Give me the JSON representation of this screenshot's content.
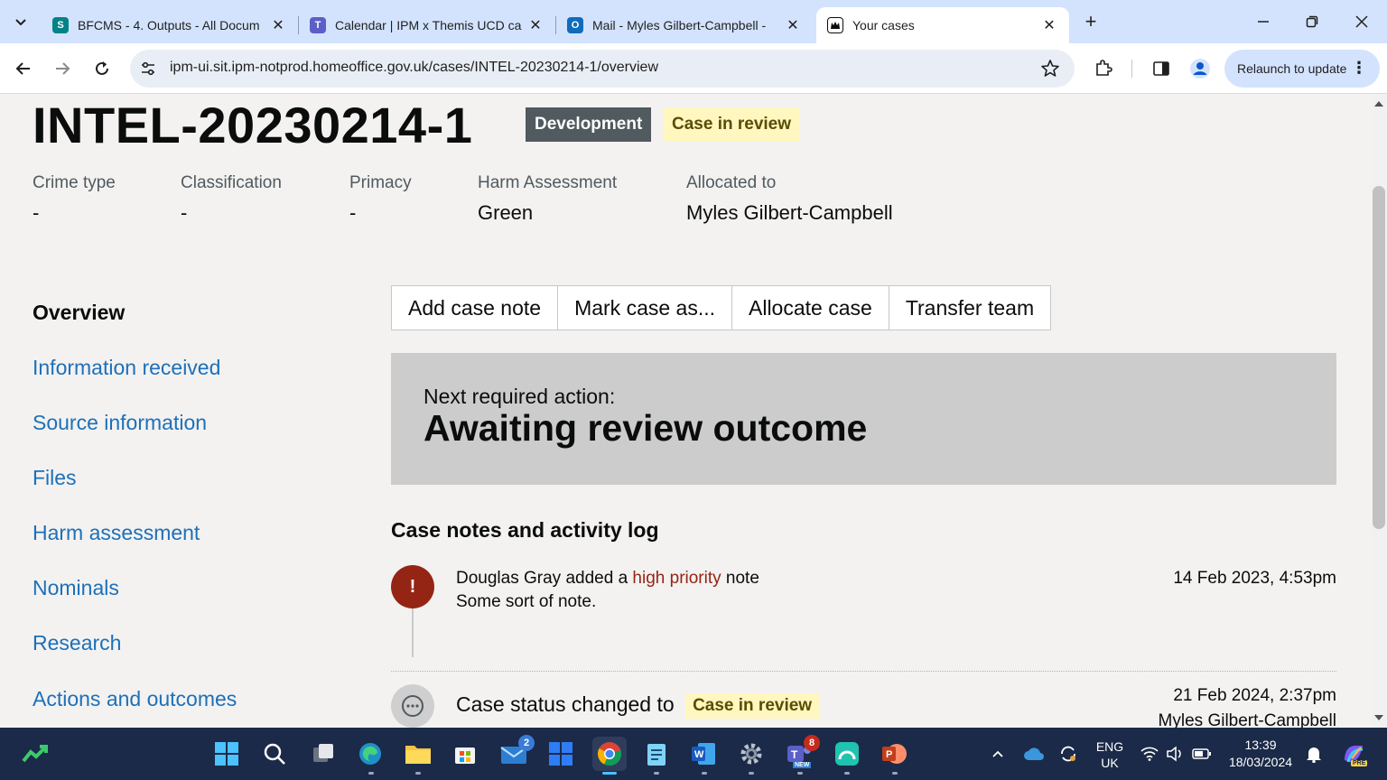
{
  "browser": {
    "tabs": [
      {
        "title": "BFCMS - 4. Outputs - All Docum",
        "favicon": "sharepoint-icon",
        "color": "#038387"
      },
      {
        "title": "Calendar | IPM x Themis UCD ca",
        "favicon": "teams-icon",
        "color": "#5b5fc7"
      },
      {
        "title": "Mail - Myles Gilbert-Campbell -",
        "favicon": "outlook-icon",
        "color": "#0f6cbd"
      },
      {
        "title": "Your cases",
        "favicon": "ho-crest-icon",
        "color": "#0b0c0c"
      }
    ],
    "close_glyph": "✕",
    "new_tab_glyph": "+",
    "url": "ipm-ui.sit.ipm-notprod.homeoffice.gov.uk/cases/INTEL-20230214-1/overview",
    "relaunch_label": "Relaunch to update"
  },
  "case": {
    "id": "INTEL-20230214-1",
    "env_tag": "Development",
    "status_tag": "Case in review",
    "meta": [
      {
        "key": "Crime type",
        "value": "-"
      },
      {
        "key": "Classification",
        "value": "-"
      },
      {
        "key": "Primacy",
        "value": "-"
      },
      {
        "key": "Harm Assessment",
        "value": "Green"
      },
      {
        "key": "Allocated to",
        "value": "Myles Gilbert-Campbell"
      }
    ]
  },
  "sidenav": {
    "items": [
      {
        "label": "Overview",
        "current": true
      },
      {
        "label": "Information received"
      },
      {
        "label": "Source information"
      },
      {
        "label": "Files"
      },
      {
        "label": "Harm assessment"
      },
      {
        "label": "Nominals"
      },
      {
        "label": "Research"
      },
      {
        "label": "Actions and outcomes"
      }
    ]
  },
  "actions": {
    "add_note": "Add case note",
    "mark_as": "Mark case as...",
    "allocate": "Allocate case",
    "transfer": "Transfer team"
  },
  "next_action": {
    "label": "Next required action:",
    "value": "Awaiting review outcome"
  },
  "log": {
    "heading": "Case notes and activity log",
    "entries": [
      {
        "author": "Douglas Gray",
        "verb": "added a",
        "priority": "high priority",
        "noun": "note",
        "body": "Some sort of note.",
        "date": "14 Feb 2023, 4:53pm",
        "icon_glyph": "!"
      },
      {
        "text": "Case status changed to",
        "status": "Case in review",
        "date": "21 Feb 2024, 2:37pm",
        "by": "Myles Gilbert-Campbell"
      }
    ]
  },
  "taskbar": {
    "mail_badge": "2",
    "teams_badge": "8",
    "teams_new": "NEW",
    "copilot_pre": "PRE",
    "lang_line1": "ENG",
    "lang_line2": "UK",
    "time": "13:39",
    "date": "18/03/2024"
  },
  "colors": {
    "link": "#1d70b8",
    "high_priority": "#942514",
    "review_tag_bg": "#fff7bf",
    "dev_tag_bg": "#505a5f"
  }
}
